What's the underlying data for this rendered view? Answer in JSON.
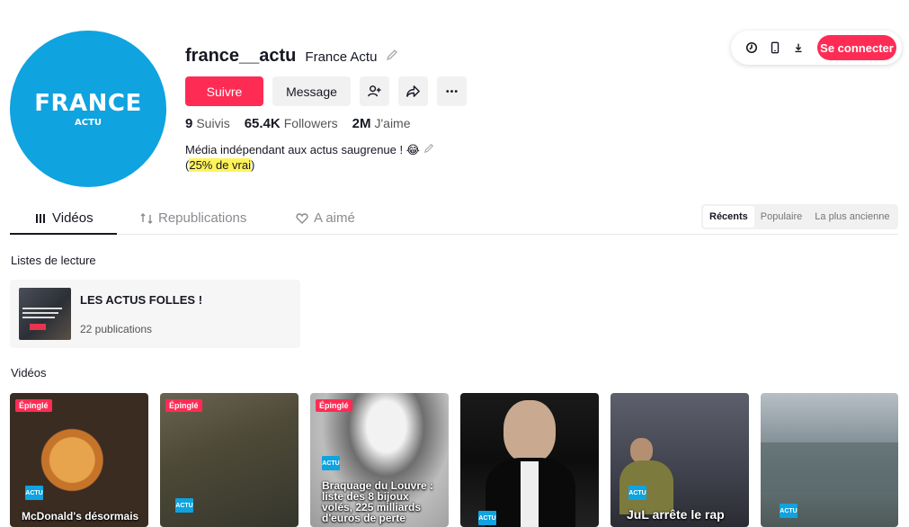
{
  "header": {
    "login_label": "Se connecter",
    "icons": [
      "clock-icon",
      "phone-icon",
      "download-icon"
    ]
  },
  "profile": {
    "avatar_brand": "FRANCE",
    "avatar_sub": "ACTU",
    "username": "france__actu",
    "nickname": "France Actu",
    "follow_label": "Suivre",
    "message_label": "Message",
    "stats": [
      {
        "value": "9",
        "label": "Suivis"
      },
      {
        "value": "65.4K",
        "label": "Followers"
      },
      {
        "value": "2M",
        "label": "J'aime"
      }
    ],
    "bio_line1": "Média indépendant aux actus saugrenue ! 😂",
    "bio_paren_open": "(",
    "bio_highlight": "25% de vrai",
    "bio_paren_close": ")"
  },
  "tabs": [
    {
      "label": "Vidéos",
      "icon": "grid-icon",
      "active": true
    },
    {
      "label": "Republications",
      "icon": "repost-icon",
      "active": false
    },
    {
      "label": "A aimé",
      "icon": "heart-icon",
      "active": false
    }
  ],
  "sort": {
    "options": [
      "Récents",
      "Populaire",
      "La plus ancienne"
    ],
    "selected": "Récents"
  },
  "playlists": {
    "title": "Listes de lecture",
    "items": [
      {
        "title": "LES ACTUS FOLLES !",
        "count": "22 publications"
      }
    ]
  },
  "videos": {
    "title": "Vidéos",
    "items": [
      {
        "pinned": "Épinglé",
        "tag": "ACTU",
        "caption": "McDonald's désormais"
      },
      {
        "pinned": "Épinglé",
        "tag": "ACTU",
        "caption": ""
      },
      {
        "pinned": "Épinglé",
        "tag": "ACTU",
        "caption": "Braquage du Louvre : liste des 8 bijoux volés, 225 milliards d'euros de perte"
      },
      {
        "pinned": "",
        "tag": "ACTU",
        "caption": ""
      },
      {
        "pinned": "",
        "tag": "ACTU",
        "caption": "JuL arrête le rap"
      },
      {
        "pinned": "",
        "tag": "ACTU",
        "caption": ""
      }
    ]
  },
  "colors": {
    "brand": "#fe2c55",
    "avatar_bg": "#0fa3df",
    "highlight": "#fff35c"
  }
}
